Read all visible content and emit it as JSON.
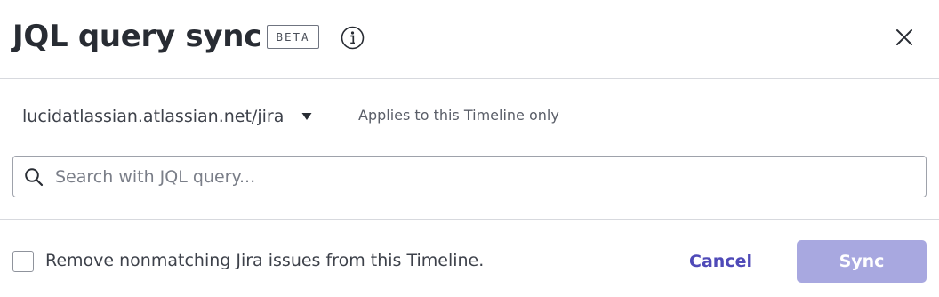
{
  "dialog": {
    "title": "JQL query sync",
    "badge": "BETA",
    "info_icon": "info-circle-icon",
    "close_icon": "close-x-icon"
  },
  "source": {
    "domain": "lucidatlassian.atlassian.net/jira",
    "dropdown_icon": "caret-down-icon",
    "scope_note": "Applies to this Timeline only"
  },
  "search": {
    "icon": "search-icon",
    "value": "",
    "placeholder": "Search with JQL query..."
  },
  "footer": {
    "remove_checkbox_checked": false,
    "remove_checkbox_label": "Remove nonmatching Jira issues from this Timeline.",
    "cancel_label": "Cancel",
    "sync_label": "Sync",
    "sync_enabled": false
  },
  "colors": {
    "accent": "#4f4ab8",
    "sync_disabled_bg": "#a8a8e0",
    "divider": "#d7d9de",
    "text": "#282c33"
  }
}
